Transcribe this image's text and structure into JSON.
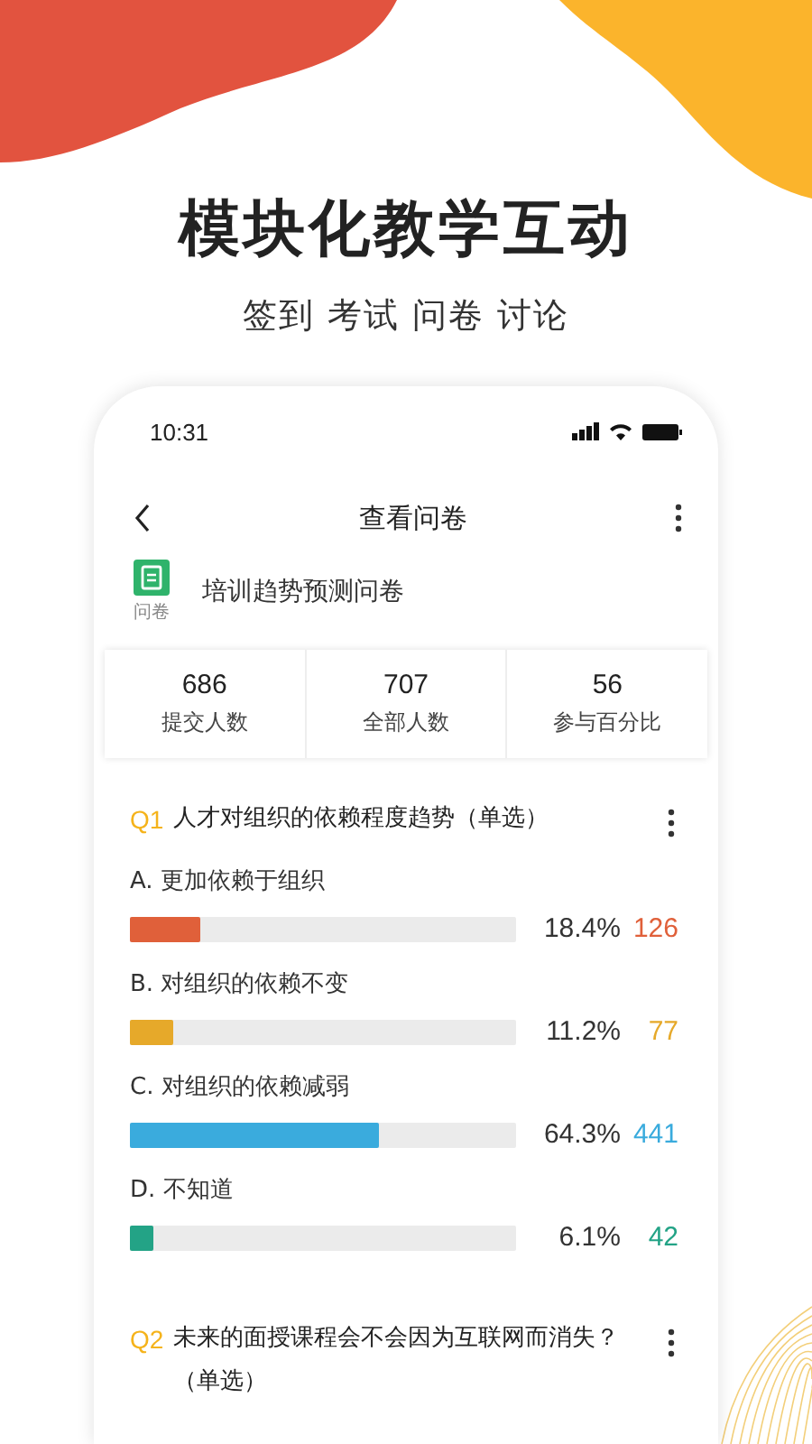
{
  "headline": "模块化教学互动",
  "subline": "签到 考试 问卷 讨论",
  "status_bar": {
    "time": "10:31"
  },
  "nav": {
    "title": "查看问卷"
  },
  "survey": {
    "badge": "问卷",
    "title": "培训趋势预测问卷"
  },
  "stats": [
    {
      "value": "686",
      "label": "提交人数"
    },
    {
      "value": "707",
      "label": "全部人数"
    },
    {
      "value": "56",
      "label": "参与百分比"
    }
  ],
  "questions": [
    {
      "number": "Q1",
      "text": "人才对组织的依赖程度趋势（单选）",
      "options": [
        {
          "label": "A. 更加依赖于组织",
          "level": 0.184,
          "percent": "18.4%",
          "count": "126",
          "color": "#e0603a"
        },
        {
          "label": "B. 对组织的依赖不变",
          "level": 0.112,
          "percent": "11.2%",
          "count": "77",
          "color": "#e6a92a"
        },
        {
          "label": "C. 对组织的依赖减弱",
          "level": 0.643,
          "percent": "64.3%",
          "count": "441",
          "color": "#3aabdd"
        },
        {
          "label": "D. 不知道",
          "level": 0.061,
          "percent": "6.1%",
          "count": "42",
          "color": "#23a386"
        }
      ]
    },
    {
      "number": "Q2",
      "text": "未来的面授课程会不会因为互联网而消失？（单选）"
    }
  ]
}
